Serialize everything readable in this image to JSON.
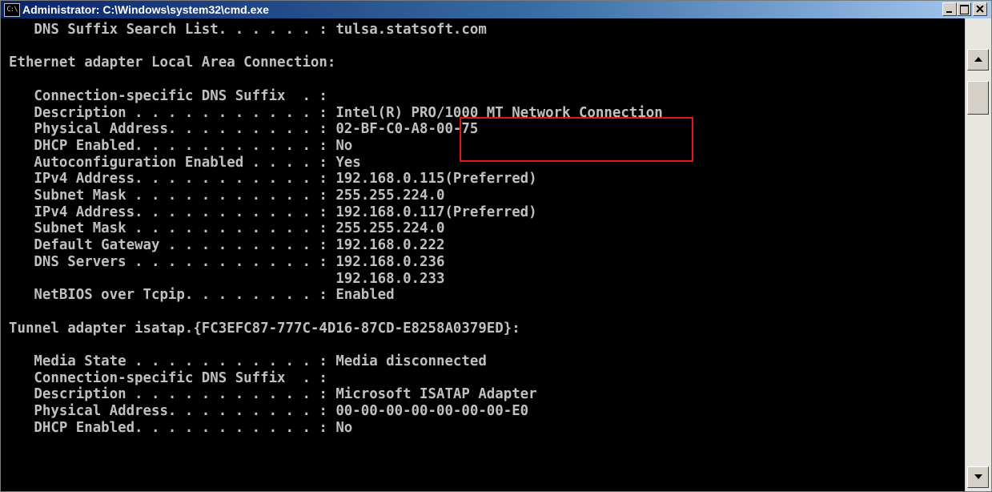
{
  "window": {
    "title": "Administrator: C:\\Windows\\system32\\cmd.exe",
    "icon_label": "C:\\"
  },
  "console": {
    "lines": [
      "   DNS Suffix Search List. . . . . . : tulsa.statsoft.com",
      "",
      "Ethernet adapter Local Area Connection:",
      "",
      "   Connection-specific DNS Suffix  . :",
      "   Description . . . . . . . . . . . : Intel(R) PRO/1000 MT Network Connection",
      "   Physical Address. . . . . . . . . : 02-BF-C0-A8-00-75",
      "   DHCP Enabled. . . . . . . . . . . : No",
      "   Autoconfiguration Enabled . . . . : Yes",
      "   IPv4 Address. . . . . . . . . . . : 192.168.0.115(Preferred)",
      "   Subnet Mask . . . . . . . . . . . : 255.255.224.0",
      "   IPv4 Address. . . . . . . . . . . : 192.168.0.117(Preferred)",
      "   Subnet Mask . . . . . . . . . . . : 255.255.224.0",
      "   Default Gateway . . . . . . . . . : 192.168.0.222",
      "   DNS Servers . . . . . . . . . . . : 192.168.0.236",
      "                                       192.168.0.233",
      "   NetBIOS over Tcpip. . . . . . . . : Enabled",
      "",
      "Tunnel adapter isatap.{FC3EFC87-777C-4D16-87CD-E8258A0379ED}:",
      "",
      "   Media State . . . . . . . . . . . : Media disconnected",
      "   Connection-specific DNS Suffix  . :",
      "   Description . . . . . . . . . . . : Microsoft ISATAP Adapter",
      "   Physical Address. . . . . . . . . : 00-00-00-00-00-00-00-E0",
      "   DHCP Enabled. . . . . . . . . . . : No"
    ]
  },
  "colors": {
    "console_background": "#000000",
    "console_text": "#c0c0c0",
    "highlight_box": "#e01818",
    "titlebar_start": "#0a246a",
    "titlebar_end": "#a6caf0"
  },
  "icons": {
    "window": "cmd-icon",
    "minimize": "minimize-icon",
    "maximize": "maximize-icon",
    "close": "close-icon",
    "scroll_up": "arrow-up-icon",
    "scroll_down": "arrow-down-icon"
  }
}
